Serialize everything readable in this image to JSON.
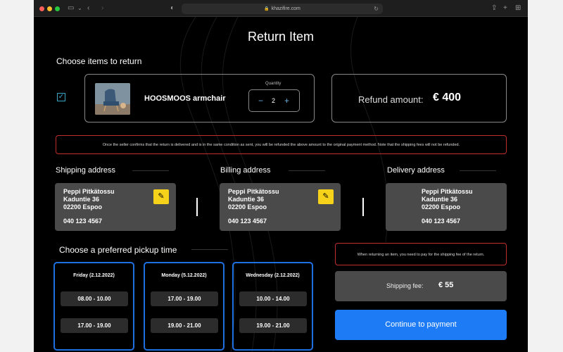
{
  "browser": {
    "url": "khazifire.com"
  },
  "page": {
    "title": "Return Item"
  },
  "items": {
    "heading": "Choose items to return",
    "product_name": "HOOSMOOS armchair",
    "quantity_label": "Quantity",
    "quantity": "2",
    "minus": "−",
    "plus": "+"
  },
  "refund": {
    "label": "Refund amount:",
    "value": "€ 400"
  },
  "notice": "Once the seller confirms that the return is delivered and is in the same condition as sent, you will be refunded the above amount to the original payment method. Note that the shipping fees will not be refunded.",
  "addresses": [
    {
      "heading": "Shipping address",
      "name": "Peppi Pitkätossu",
      "street": "Kaduntie 36",
      "postal": "02200 Espoo",
      "phone": "040 123 4567"
    },
    {
      "heading": "Billing address",
      "name": "Peppi Pitkätossu",
      "street": "Kaduntie 36",
      "postal": "02200 Espoo",
      "phone": "040 123 4567"
    },
    {
      "heading": "Delivery address",
      "name": "Peppi Pitkätossu",
      "street": "Kaduntie 36",
      "postal": "02200 Espoo",
      "phone": "040 123 4567"
    }
  ],
  "pickup": {
    "heading": "Choose a preferred pickup time",
    "days": [
      {
        "day": "Friday (2.12.2022)",
        "slots": [
          "08.00 - 10.00",
          "17.00 - 19.00"
        ]
      },
      {
        "day": "Monday (5.12.2022)",
        "slots": [
          "17.00 - 19.00",
          "19.00 - 21.00"
        ]
      },
      {
        "day": "Wednesday (2.12.2022)",
        "slots": [
          "10.00 - 14.00",
          "19.00 - 21.00"
        ]
      }
    ]
  },
  "shipping": {
    "notice": "When returning an item, you need to pay for the shipping fee of the return.",
    "fee_label": "Shipping fee:",
    "fee_value": "€ 55"
  },
  "cta": {
    "label": "Continue to payment"
  },
  "colors": {
    "accent": "#1d7bf5",
    "edit": "#f6d21a",
    "warning": "#c02e2e",
    "card": "#4a4a4a"
  }
}
